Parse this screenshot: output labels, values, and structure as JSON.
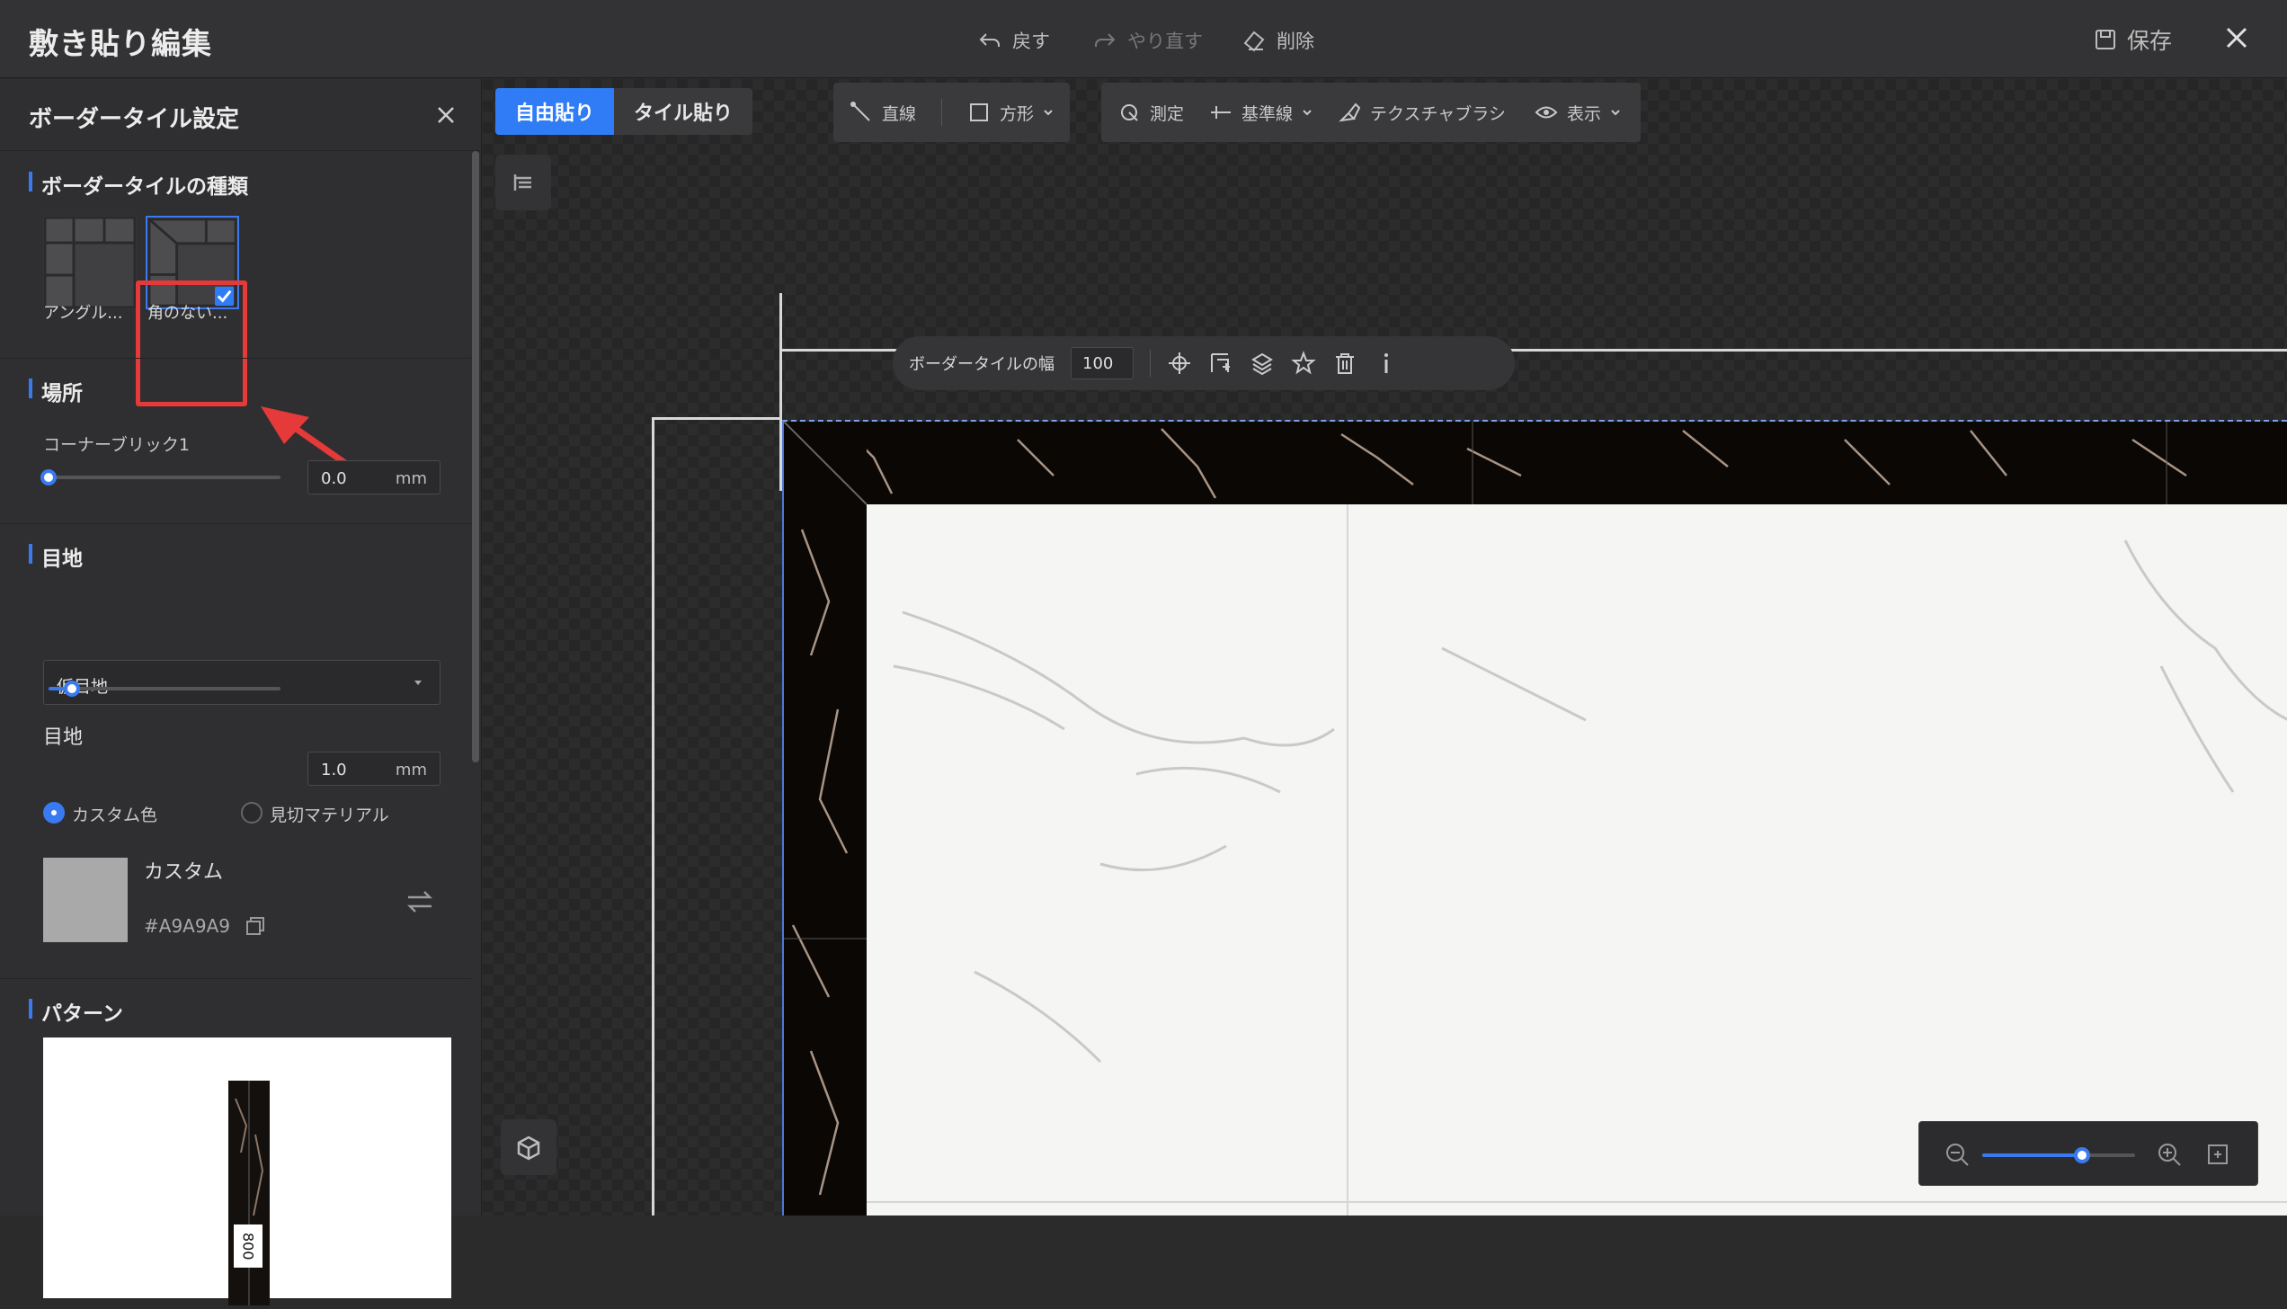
{
  "app": {
    "title": "敷き貼り編集"
  },
  "toolbar": {
    "undo": "戻す",
    "redo": "やり直す",
    "delete": "削除",
    "save": "保存"
  },
  "sidebar": {
    "title": "ボーダータイル設定",
    "type_section": {
      "label": "ボーダータイルの種類",
      "options": [
        {
          "label": "アングル...",
          "selected": false
        },
        {
          "label": "角のない...",
          "selected": true
        }
      ]
    },
    "location_section": {
      "label": "場所",
      "corner_label": "コーナーブリック1",
      "corner_value": "0.0",
      "corner_unit": "mm",
      "corner_slider_fraction": 0.0
    },
    "joint_section": {
      "label": "目地",
      "joint_type": "仮目地",
      "joint_width_label": "目地",
      "joint_width_value": "1.0",
      "joint_width_unit": "mm",
      "joint_slider_fraction": 0.1,
      "radio_custom": "カスタム色",
      "radio_material": "見切マテリアル",
      "color_name": "カスタム",
      "color_hex": "#A9A9A9"
    },
    "pattern_section": {
      "label": "パターン",
      "dimension": "800"
    }
  },
  "canvas": {
    "mode_tabs": [
      {
        "label": "自由貼り",
        "active": true
      },
      {
        "label": "タイル貼り",
        "active": false
      }
    ],
    "tools": {
      "line": "直線",
      "rect": "方形",
      "measure": "測定",
      "guide": "基準線",
      "brush": "テクスチャブラシ",
      "view": "表示"
    },
    "float_toolbar": {
      "width_label": "ボーダータイルの幅",
      "width_value": "100"
    },
    "zoom_fraction": 0.65
  },
  "colors": {
    "accent": "#2F7CF6",
    "highlight": "#E63A3A",
    "joint": "#A9A9A9"
  }
}
